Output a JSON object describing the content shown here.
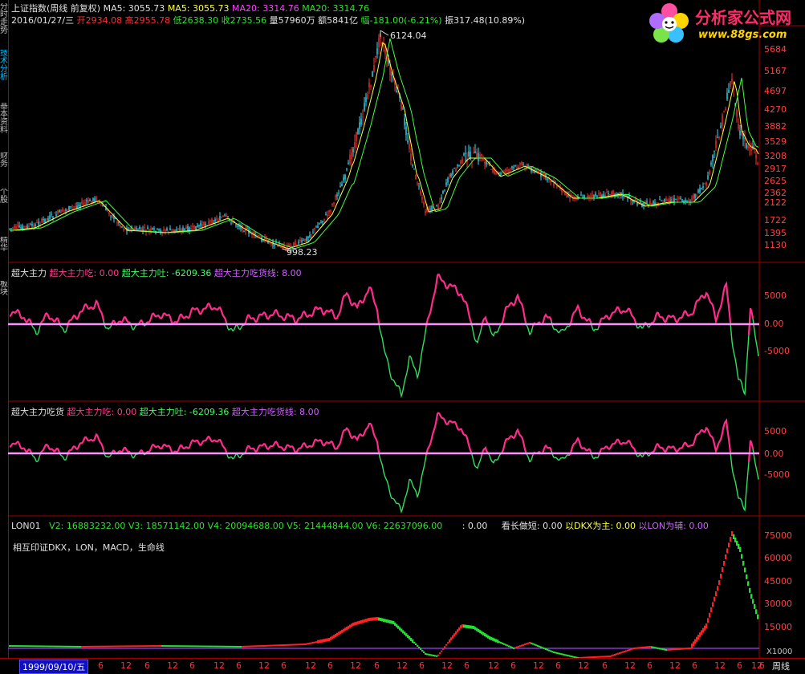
{
  "sidebar": {
    "tabs": [
      "分时走势",
      "技术分析",
      "基本资料",
      "财务",
      "个股",
      "精华",
      "板块"
    ],
    "active_index": 1
  },
  "header": {
    "line1": {
      "index_name": "上证指数(周线 前复权)",
      "ma5a": "MA5: 3055.73",
      "ma5b": "MA5: 3055.73",
      "ma20a": "MA20: 3314.76",
      "ma20b": "MA20: 3314.76"
    },
    "line2": {
      "date": "2016/01/27/三",
      "open": "开2934.08",
      "high": "高2955.78",
      "low": "低2638.30",
      "close": "收2735.56",
      "volume": "量57960万",
      "amount": "额5841亿",
      "change": "幅-181.00(-6.21%)",
      "amplitude": "振317.48(10.89%)"
    }
  },
  "logo": {
    "title": "分析家公式网",
    "url": "www.88gs.com"
  },
  "price_panel": {
    "high_label": "6124.04",
    "low_label": "998.23",
    "ticks": [
      "5684",
      "5167",
      "4697",
      "4270",
      "3882",
      "3529",
      "3208",
      "2917",
      "2625",
      "2362",
      "2122",
      "1722",
      "1395",
      "1130"
    ]
  },
  "indicator1": {
    "name": "超大主力",
    "eat": "超大主力吃: 0.00",
    "spit": "超大主力吐: -6209.36",
    "line": "超大主力吃货线: 8.00",
    "ticks": [
      "5000",
      "0.00",
      "-5000"
    ]
  },
  "indicator2": {
    "name": "超大主力吃货",
    "eat": "超大主力吃: 0.00",
    "spit": "超大主力吐: -6209.36",
    "line": "超大主力吃货线: 8.00",
    "ticks": [
      "5000",
      "0.00",
      "-5000"
    ]
  },
  "lon_panel": {
    "name": "LON01",
    "v2": "V2: 16883232.00",
    "v3": "V3: 18571142.00",
    "v4": "V4: 20094688.00",
    "v5": "V5: 21444844.00",
    "v6": "V6: 22637096.00",
    "blank": ": 0.00",
    "long_short": "看长做短: 0.00",
    "dkx": "以DKX为主: 0.00",
    "lon_aux": "以LON为辅: 0.00",
    "note": "相互印证DKX，LON，MACD，生命线",
    "ticks": [
      "75000",
      "60000",
      "45000",
      "30000",
      "15000"
    ],
    "multiplier": "X1000"
  },
  "bottom": {
    "cursor_date": "1999/09/10/五",
    "period": "周线",
    "date_ticks": [
      "6",
      "12",
      "6",
      "12",
      "6",
      "12",
      "6",
      "12",
      "6",
      "12",
      "6",
      "12",
      "6",
      "12",
      "6",
      "12",
      "6",
      "12",
      "6",
      "12",
      "6",
      "12",
      "6",
      "12",
      "6",
      "12",
      "6",
      "12",
      "6",
      "12",
      "6",
      "12",
      "6"
    ]
  }
}
